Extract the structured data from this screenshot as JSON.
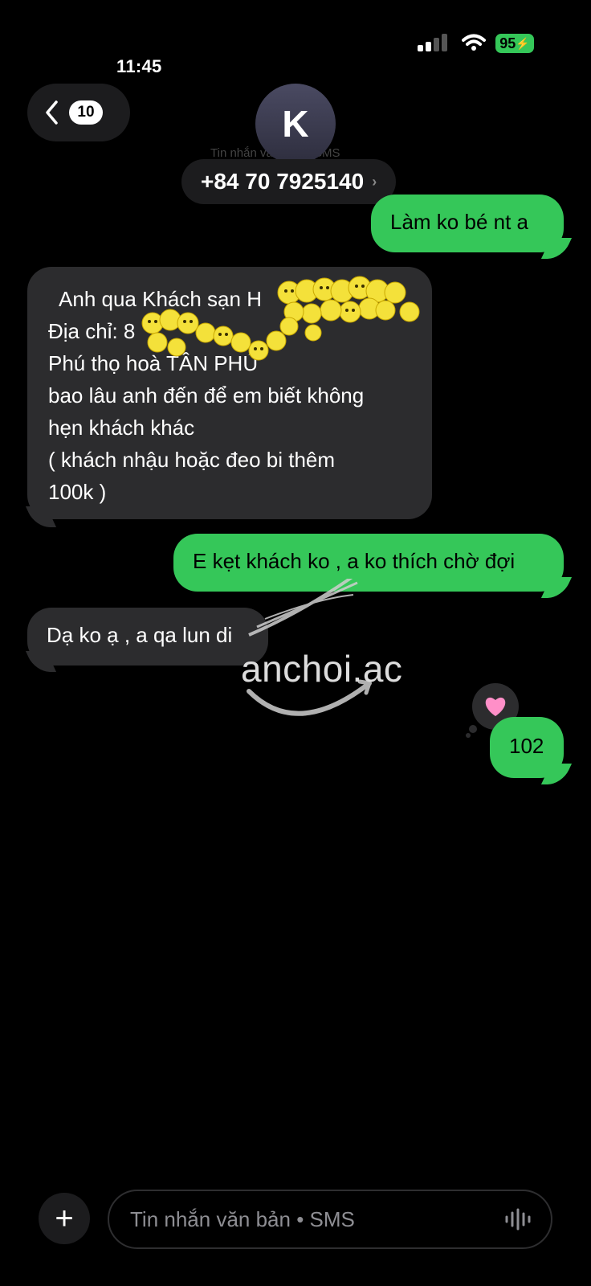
{
  "status_bar": {
    "time": "11:45",
    "battery": "95"
  },
  "header": {
    "unread_count": "10",
    "avatar_initial": "K",
    "subline": "Tin nhắn văn bản • SMS",
    "phone": "+84 70 7925140"
  },
  "messages": [
    {
      "dir": "out",
      "lines": [
        "Làm ko bé nt a"
      ]
    },
    {
      "dir": "in",
      "lines": [
        "  Anh qua Khách sạn H",
        "Địa chỉ: 8",
        "Phú thọ hoà TÂN PHÚ",
        "bao lâu anh đến để em biết không",
        "hẹn khách khác",
        "( khách nhậu hoặc đeo bi thêm",
        "100k )"
      ]
    },
    {
      "dir": "out",
      "lines": [
        "E kẹt khách ko , a ko thích chờ đợi"
      ]
    },
    {
      "dir": "in",
      "lines": [
        "Dạ ko ạ , a qa lun di"
      ]
    },
    {
      "dir": "out",
      "lines": [
        "102"
      ]
    }
  ],
  "watermark": "anchoi.ac",
  "composer": {
    "placeholder": "Tin nhắn văn bản • SMS"
  },
  "icons": [
    "back-chevron-icon",
    "signal-icon",
    "wifi-icon",
    "battery-icon",
    "heart-icon",
    "plus-icon",
    "audio-wave-icon"
  ]
}
